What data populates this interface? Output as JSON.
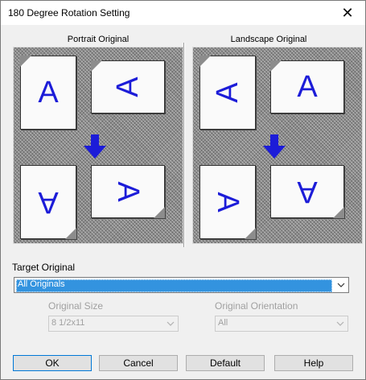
{
  "window": {
    "title": "180 Degree Rotation Setting",
    "close_glyph": "✕"
  },
  "portrait": {
    "label": "Portrait Original",
    "glyph_top_left": "A",
    "glyph_top_right": "A",
    "glyph_bottom_left": "A",
    "glyph_bottom_right": "A"
  },
  "landscape": {
    "label": "Landscape Original",
    "glyph_top_left": "A",
    "glyph_top_right": "A",
    "glyph_bottom_left": "A",
    "glyph_bottom_right": "A"
  },
  "colors": {
    "accent": "#1c1cd8",
    "selection": "#3393df"
  },
  "target_original": {
    "label": "Target Original",
    "value": "All Originals"
  },
  "original_size": {
    "label": "Original Size",
    "value": "8 1/2x11"
  },
  "original_orientation": {
    "label": "Original Orientation",
    "value": "All"
  },
  "buttons": {
    "ok": "OK",
    "cancel": "Cancel",
    "default": "Default",
    "help": "Help"
  }
}
